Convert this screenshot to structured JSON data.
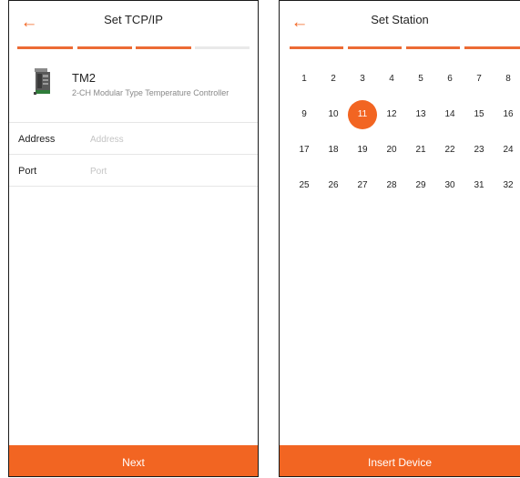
{
  "colors": {
    "accent": "#f26522",
    "step_active": "#ec6b35",
    "step_inactive": "#e9e9e9"
  },
  "left_screen": {
    "back_icon": "arrow-left-icon",
    "title": "Set TCP/IP",
    "steps": [
      "active",
      "active",
      "active",
      "inactive"
    ],
    "device": {
      "icon": "modular-controller-device-image",
      "name": "TM2",
      "description": "2-CH Modular Type Temperature Controller"
    },
    "fields": [
      {
        "label": "Address",
        "value": "",
        "placeholder": "Address"
      },
      {
        "label": "Port",
        "value": "",
        "placeholder": "Port"
      }
    ],
    "button_label": "Next"
  },
  "right_screen": {
    "back_icon": "arrow-left-icon",
    "title": "Set Station",
    "steps": [
      "active",
      "active",
      "active",
      "active"
    ],
    "stations": [
      "1",
      "2",
      "3",
      "4",
      "5",
      "6",
      "7",
      "8",
      "9",
      "10",
      "11",
      "12",
      "13",
      "14",
      "15",
      "16",
      "17",
      "18",
      "19",
      "20",
      "21",
      "22",
      "23",
      "24",
      "25",
      "26",
      "27",
      "28",
      "29",
      "30",
      "31",
      "32"
    ],
    "selected_station": "11",
    "button_label": "Insert Device"
  }
}
